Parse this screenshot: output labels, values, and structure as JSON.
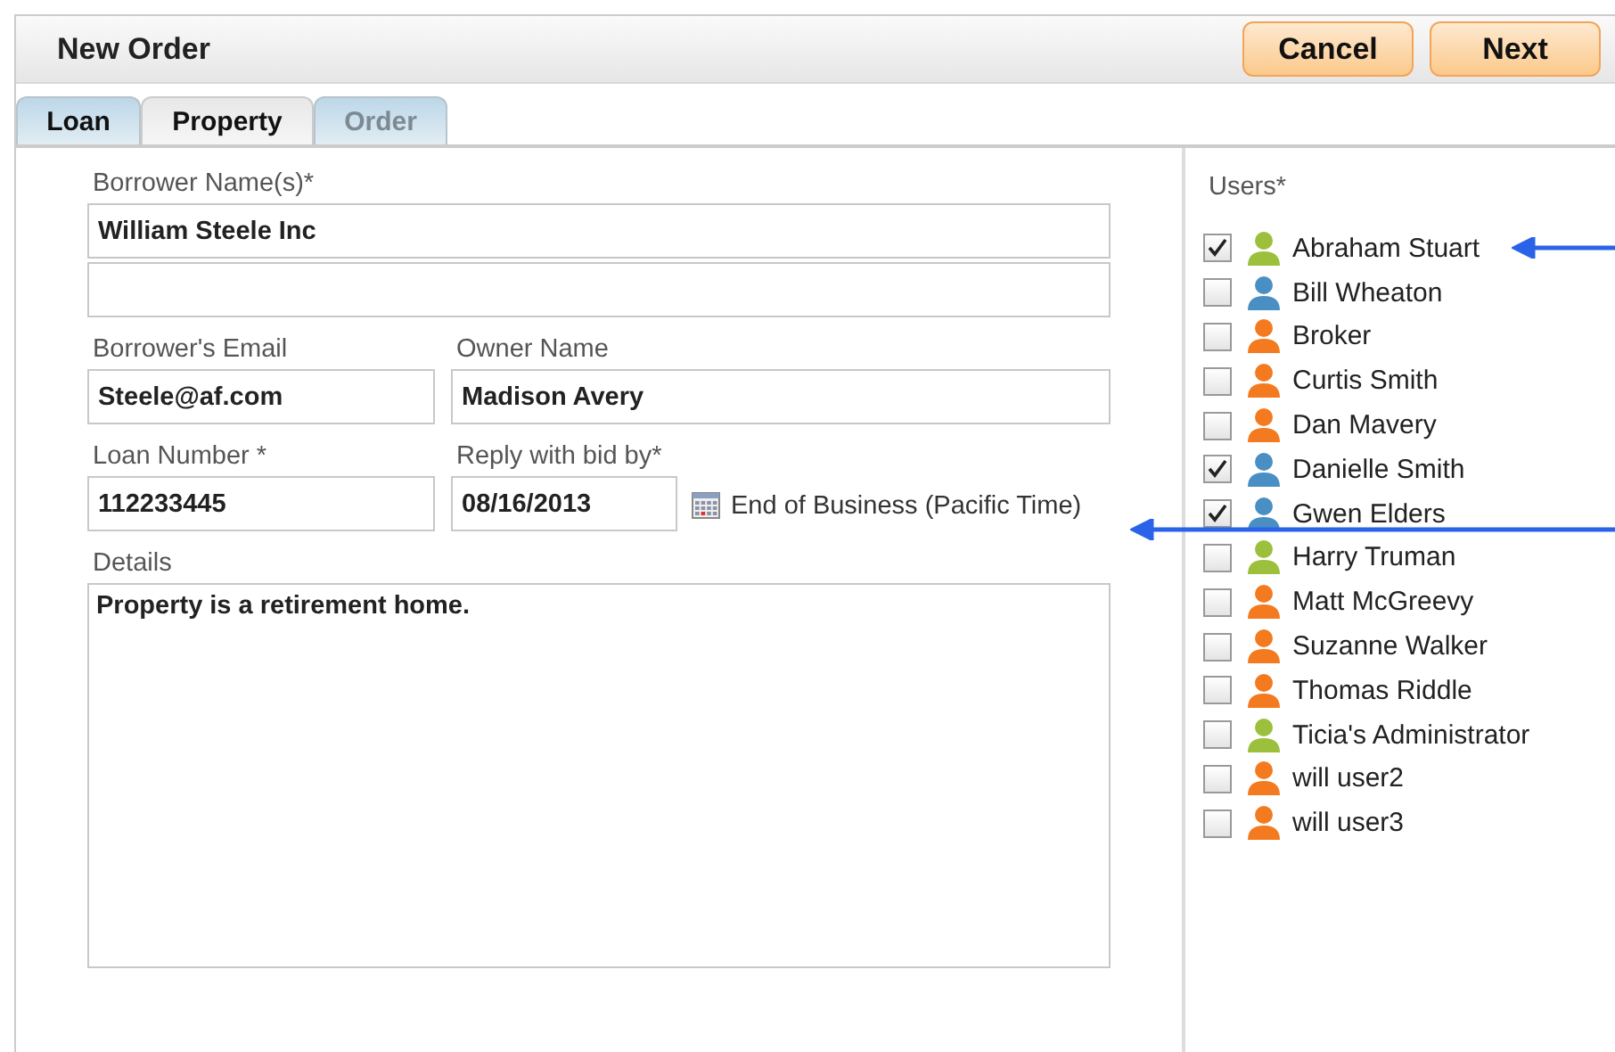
{
  "window": {
    "title": "New Order"
  },
  "buttons": [
    {
      "label": "Cancel"
    },
    {
      "label": "Next"
    }
  ],
  "tabs": [
    {
      "label": "Loan",
      "selected": false,
      "disabled": false
    },
    {
      "label": "Property",
      "selected": true,
      "disabled": false
    },
    {
      "label": "Order",
      "selected": false,
      "disabled": true
    }
  ],
  "form": {
    "borrower_names": {
      "label": "Borrower Name(s)*",
      "value": "William Steele Inc"
    },
    "borrower_email": {
      "label": "Borrower's Email",
      "value": "Steele@af.com"
    },
    "owner_name": {
      "label": "Owner Name",
      "value": "Madison Avery"
    },
    "loan_number": {
      "label": "Loan Number *",
      "value": "112233445"
    },
    "reply_by": {
      "label": "Reply with bid by*",
      "value": "08/16/2013",
      "note": "End of Business (Pacific Time)"
    },
    "details": {
      "label": "Details",
      "value": "Property is a retirement home."
    }
  },
  "users": {
    "label": "Users*",
    "items": [
      {
        "name": "Abraham Stuart",
        "checked": true,
        "color": "#9cbf3c"
      },
      {
        "name": "Bill Wheaton",
        "checked": false,
        "color": "#4a8fc4"
      },
      {
        "name": "Broker",
        "checked": false,
        "color": "#f47a1f"
      },
      {
        "name": "Curtis Smith",
        "checked": false,
        "color": "#f47a1f"
      },
      {
        "name": "Dan Mavery",
        "checked": false,
        "color": "#f47a1f"
      },
      {
        "name": "Danielle Smith",
        "checked": true,
        "color": "#4a8fc4"
      },
      {
        "name": "Gwen Elders",
        "checked": true,
        "color": "#4a8fc4"
      },
      {
        "name": "Harry Truman",
        "checked": false,
        "color": "#9cbf3c"
      },
      {
        "name": "Matt McGreevy",
        "checked": false,
        "color": "#f47a1f"
      },
      {
        "name": "Suzanne Walker",
        "checked": false,
        "color": "#f47a1f"
      },
      {
        "name": "Thomas Riddle",
        "checked": false,
        "color": "#f47a1f"
      },
      {
        "name": "Ticia's Administrator",
        "checked": false,
        "color": "#9cbf3c"
      },
      {
        "name": "will user2",
        "checked": false,
        "color": "#f47a1f"
      },
      {
        "name": "will user3",
        "checked": false,
        "color": "#f47a1f"
      }
    ]
  }
}
